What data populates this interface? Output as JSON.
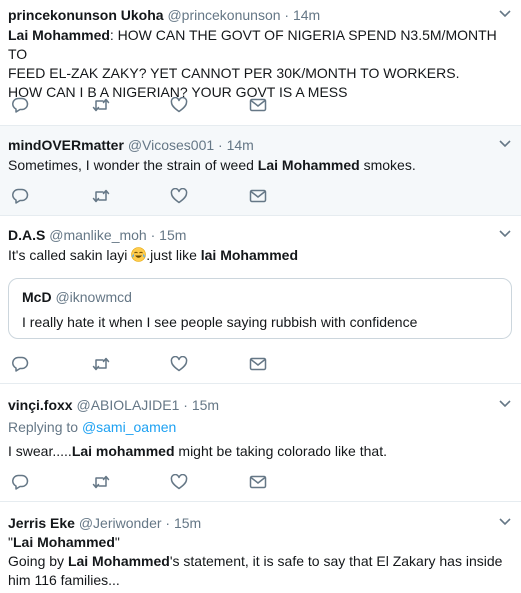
{
  "tweets": [
    {
      "name": "princekonunson Ukoha",
      "handle": "@princekonunson",
      "time": "14m",
      "text_bold": "Lai Mohammed",
      "text_lines": [
        ": HOW CAN THE GOVT OF NIGERIA SPEND N3.5M/MONTH TO",
        "FEED EL-ZAK  ZAKY? YET CANNOT PER 30K/MONTH TO WORKERS.",
        "HOW CAN I B A NIGERIAN? YOUR GOVT IS A MESS"
      ]
    },
    {
      "name": "mindOVERmatter",
      "handle": "@Vicoses001",
      "time": "14m",
      "text_before": "Sometimes, I wonder the strain of weed ",
      "text_bold": "Lai Mohammed",
      "text_after": " smokes."
    },
    {
      "name": "D.A.S",
      "handle": "@manlike_moh",
      "time": "15m",
      "text_before": "It's called sakin  layi ",
      "text_middle": ".just like ",
      "text_bold": "lai Mohammed",
      "quote": {
        "name": "McD",
        "handle": "@iknowmcd",
        "text": "I really hate it when I see people saying rubbish with confidence"
      }
    },
    {
      "name": "vinçi.foxx",
      "handle": "@ABIOLAJIDE1",
      "time": "15m",
      "replying_label": "Replying to ",
      "replying_handle": "@sami_oamen",
      "text_before": "I swear.....",
      "text_bold": "Lai mohammed",
      "text_after": " might be taking colorado like that."
    },
    {
      "name": "Jerris Eke",
      "handle": "@Jeriwonder",
      "time": "15m",
      "quote_open": "\"",
      "quote_bold": "Lai Mohammed",
      "quote_close": "\"",
      "text_before": "Going by ",
      "text_bold": "Lai Mohammed",
      "text_after": "'s statement, it is safe to say that El Zakary has inside",
      "text_line2": "him 116 families..."
    }
  ],
  "sep": "·",
  "icons": {
    "reply": "reply-icon",
    "retweet": "retweet-icon",
    "like": "like-icon",
    "dm": "direct-message-icon",
    "caret": "chevron-down-icon",
    "emoji": "face-with-tears-of-joy-emoji"
  },
  "colors": {
    "text": "#14171a",
    "secondary": "#657786",
    "link": "#1da1f2",
    "border": "#e6ecf0",
    "highlight_bg": "#f5f8fa"
  }
}
